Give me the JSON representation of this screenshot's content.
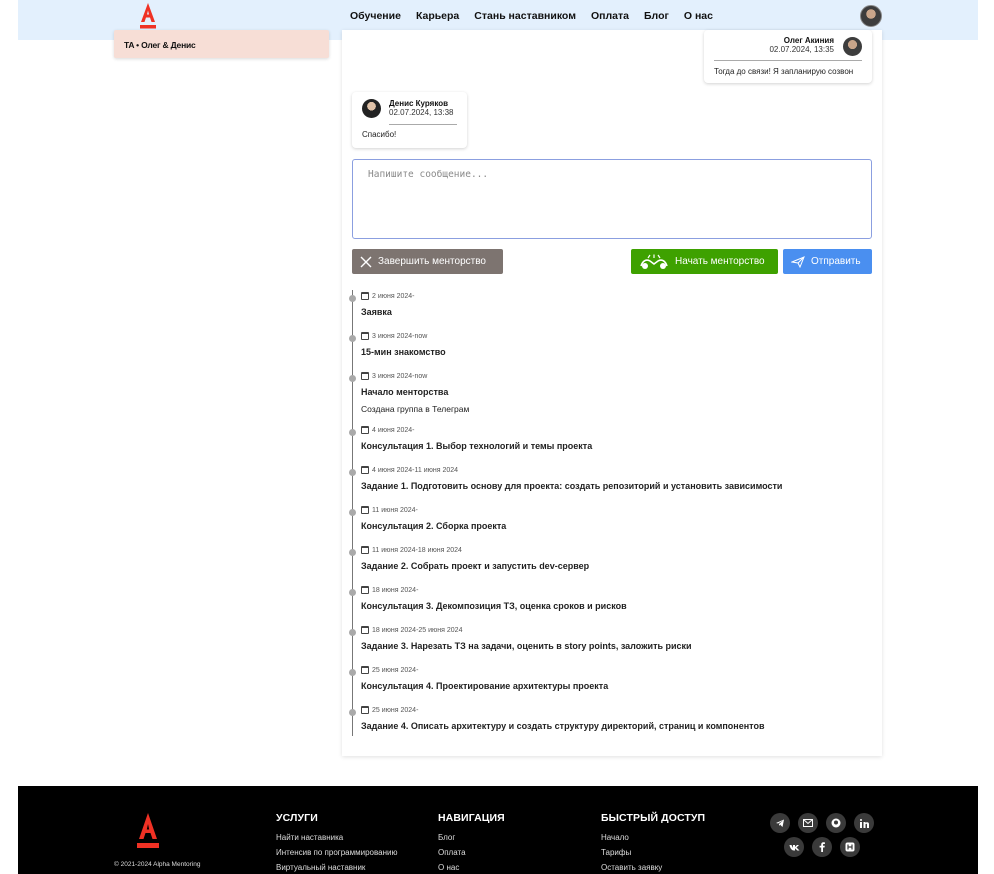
{
  "header": {
    "nav": [
      "Обучение",
      "Карьера",
      "Стань наставником",
      "Оплата",
      "Блог",
      "О нас"
    ]
  },
  "sidebar": {
    "group_title": "TA • Олег & Денис"
  },
  "chat": {
    "messages": [
      {
        "author": "Олег Акиния",
        "time": "02.07.2024, 13:35",
        "text": "Тогда до связи! Я запланирую созвон",
        "side": "right"
      },
      {
        "author": "Денис Куряков",
        "time": "02.07.2024, 13:38",
        "text": "Спасибо!",
        "side": "left"
      }
    ],
    "input_placeholder": "Напишите сообщение...",
    "buttons": {
      "finish": "Завершить менторство",
      "start": "Начать менторство",
      "send": "Отправить"
    },
    "colors": {
      "finish": "#7d7470",
      "start": "#3ea100",
      "send": "#4a8ff0"
    }
  },
  "timeline": [
    {
      "date": "2 июня 2024-",
      "title": "Заявка"
    },
    {
      "date": "3 июня 2024-now",
      "title": "15-мин знакомство"
    },
    {
      "date": "3 июня 2024-now",
      "title": "Начало менторства",
      "desc": "Создана группа в Телеграм"
    },
    {
      "date": "4 июня 2024-",
      "title": "Консультация 1. Выбор технологий и темы проекта"
    },
    {
      "date": "4 июня 2024-11 июня 2024",
      "title": "Задание 1. Подготовить основу для проекта: создать репозиторий и установить зависимости"
    },
    {
      "date": "11 июня 2024-",
      "title": "Консультация 2. Сборка проекта"
    },
    {
      "date": "11 июня 2024-18 июня 2024",
      "title": "Задание 2. Собрать проект и запустить dev-сервер"
    },
    {
      "date": "18 июня 2024-",
      "title": "Консультация 3. Декомпозиция ТЗ, оценка сроков и рисков"
    },
    {
      "date": "18 июня 2024-25 июня 2024",
      "title": "Задание 3. Нарезать ТЗ на задачи, оценить в story points, заложить риски"
    },
    {
      "date": "25 июня 2024-",
      "title": "Консультация 4. Проектирование архитектуры проекта"
    },
    {
      "date": "25 июня 2024-",
      "title": "Задание 4. Описать архитектуру и создать структуру директорий, страниц и компонентов"
    }
  ],
  "footer": {
    "copyright": "© 2021-2024 Alpha Mentoring",
    "columns": [
      {
        "title": "УСЛУГИ",
        "links": [
          "Найти наставника",
          "Интенсив по программированию",
          "Виртуальный наставник"
        ]
      },
      {
        "title": "НАВИГАЦИЯ",
        "links": [
          "Блог",
          "Оплата",
          "О нас"
        ]
      },
      {
        "title": "БЫСТРЫЙ ДОСТУП",
        "links": [
          "Начало",
          "Тарифы",
          "Оставить заявку"
        ]
      }
    ],
    "socials": [
      "telegram-icon",
      "mail-icon",
      "github-icon",
      "linkedin-icon",
      "vk-icon",
      "facebook-icon",
      "habr-icon"
    ]
  },
  "brand_color": "#ef3124"
}
